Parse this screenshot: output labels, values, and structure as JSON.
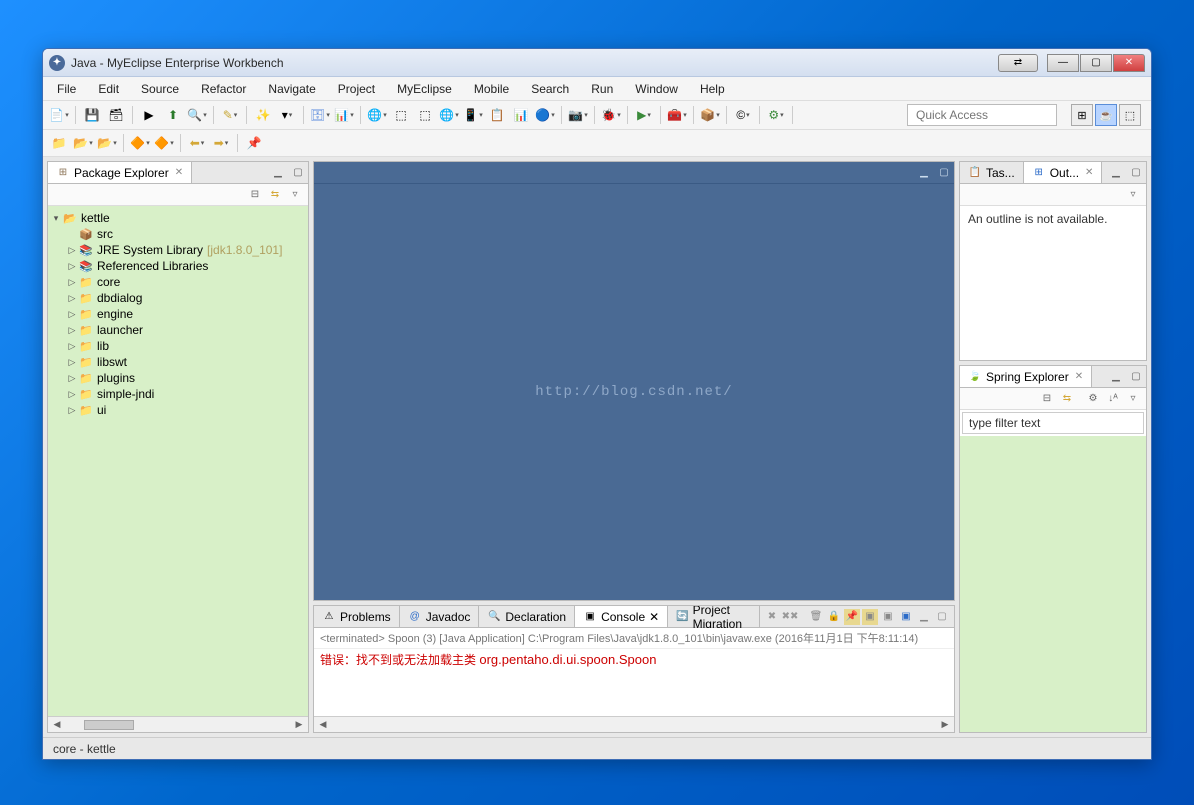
{
  "title": "Java - MyEclipse Enterprise Workbench",
  "menu": [
    "File",
    "Edit",
    "Source",
    "Refactor",
    "Navigate",
    "Project",
    "MyEclipse",
    "Mobile",
    "Search",
    "Run",
    "Window",
    "Help"
  ],
  "quickaccess_placeholder": "Quick Access",
  "package_explorer": {
    "title": "Package Explorer",
    "project": "kettle",
    "nodes": [
      {
        "icon": "pkg",
        "label": "src",
        "indent": 1,
        "exp": ""
      },
      {
        "icon": "jar",
        "label": "JRE System Library",
        "suffix": "[jdk1.8.0_101]",
        "indent": 1,
        "exp": "▷"
      },
      {
        "icon": "jar",
        "label": "Referenced Libraries",
        "indent": 1,
        "exp": "▷"
      },
      {
        "icon": "folder",
        "label": "core",
        "indent": 1,
        "exp": "▷"
      },
      {
        "icon": "folder",
        "label": "dbdialog",
        "indent": 1,
        "exp": "▷"
      },
      {
        "icon": "folder",
        "label": "engine",
        "indent": 1,
        "exp": "▷"
      },
      {
        "icon": "folder",
        "label": "launcher",
        "indent": 1,
        "exp": "▷"
      },
      {
        "icon": "folder",
        "label": "lib",
        "indent": 1,
        "exp": "▷"
      },
      {
        "icon": "folder",
        "label": "libswt",
        "indent": 1,
        "exp": "▷"
      },
      {
        "icon": "folder",
        "label": "plugins",
        "indent": 1,
        "exp": "▷"
      },
      {
        "icon": "folder",
        "label": "simple-jndi",
        "indent": 1,
        "exp": "▷"
      },
      {
        "icon": "folder",
        "label": "ui",
        "indent": 1,
        "exp": "▷"
      }
    ]
  },
  "editor_watermark": "http://blog.csdn.net/",
  "right_tabs": {
    "tasks": "Tas...",
    "outline": "Out..."
  },
  "outline_msg": "An outline is not available.",
  "spring": {
    "title": "Spring Explorer",
    "filter": "type filter text"
  },
  "bottom_tabs": {
    "problems": "Problems",
    "javadoc": "Javadoc",
    "declaration": "Declaration",
    "console": "Console",
    "migration": "Project Migration"
  },
  "console": {
    "info": "<terminated> Spoon (3) [Java Application] C:\\Program Files\\Java\\jdk1.8.0_101\\bin\\javaw.exe (2016年11月1日 下午8:11:14)",
    "err_prefix": "错误：找不到或无法加载主类",
    "err_class": "org.pentaho.di.ui.spoon.Spoon"
  },
  "status": "core - kettle"
}
